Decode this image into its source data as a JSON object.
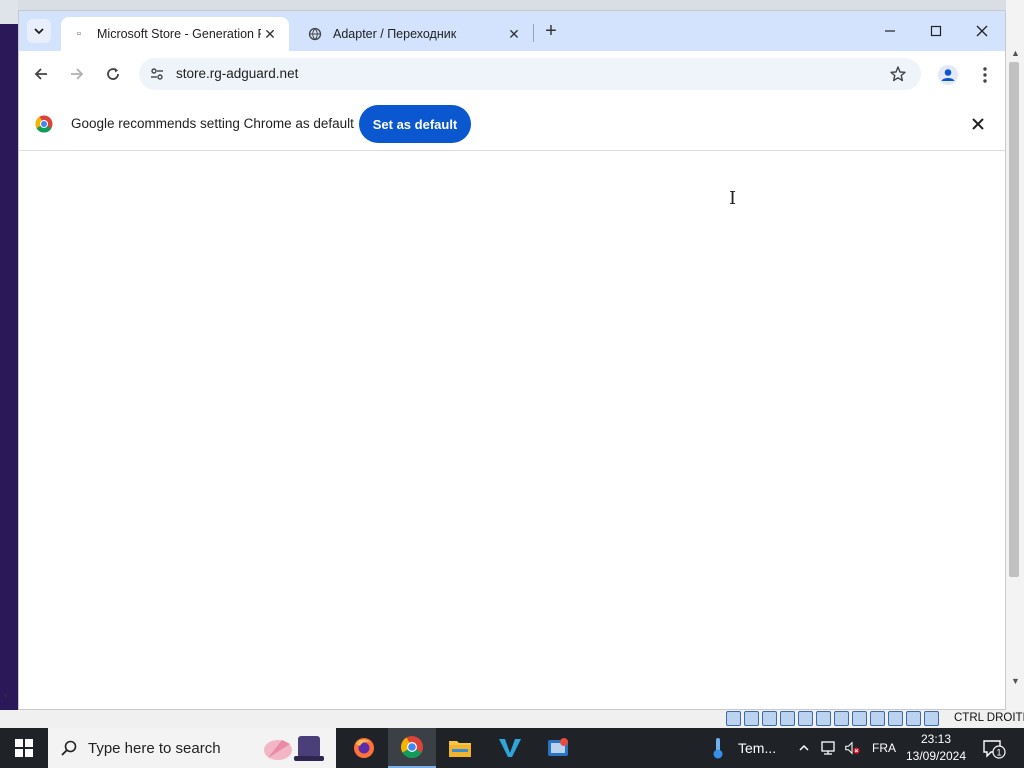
{
  "browser": {
    "tabs": [
      {
        "title": "Microsoft Store - Generation Pr",
        "active": true
      },
      {
        "title": "Adapter / Переходник",
        "active": false
      }
    ],
    "address": {
      "url": "store.rg-adguard.net"
    }
  },
  "infobar": {
    "message": "Google recommends setting Chrome as default",
    "button_label": "Set as default"
  },
  "vm_status": {
    "host_key": "CTRL DROITE"
  },
  "taskbar": {
    "search_placeholder": "Type here to search",
    "weather_text": "Tem...",
    "language": "FRA",
    "time": "23:13",
    "date": "13/09/2024",
    "notification_count": "1"
  },
  "colors": {
    "tabstrip": "#d3e3fd",
    "accent_button": "#0b57d0",
    "taskbar": "#1f2227"
  },
  "icons": [
    "chevron-down-icon",
    "close-icon",
    "plus-icon",
    "minimize-icon",
    "maximize-icon",
    "back-icon",
    "forward-icon",
    "reload-icon",
    "site-info-icon",
    "star-icon",
    "profile-icon",
    "more-vert-icon",
    "chrome-logo-icon",
    "windows-logo-icon",
    "search-icon",
    "firefox-icon",
    "chrome-icon",
    "file-explorer-icon",
    "thermometer-icon",
    "network-icon",
    "volume-icon",
    "notification-icon"
  ]
}
